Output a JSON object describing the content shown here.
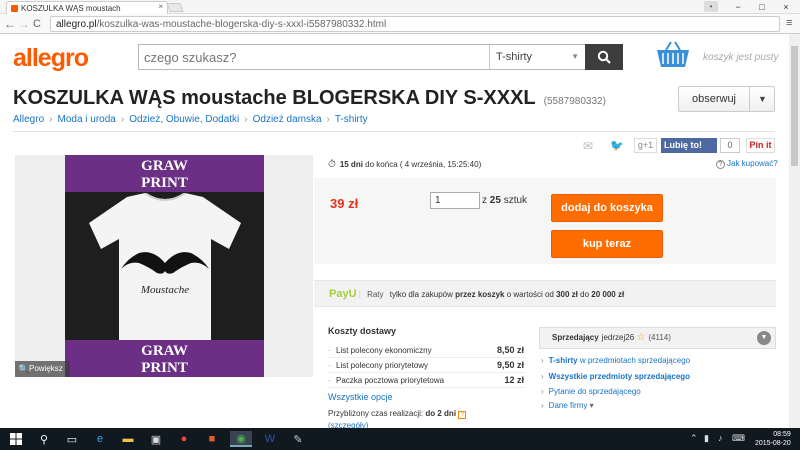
{
  "browser": {
    "tab_title": "KOSZULKA WĄS moustach",
    "tab_close": "×",
    "url_host": "allegro.pl",
    "url_path": "/koszulka-was-moustache-blogerska-diy-s-xxxl-i5587980332.html",
    "back": "←",
    "forward": "→",
    "reload": "C",
    "menu": "≡",
    "minimize": "−",
    "maximize": "□",
    "close": "×"
  },
  "header": {
    "logo": "allegro",
    "search_placeholder": "czego szukasz?",
    "category": "T-shirty",
    "basket_label": "koszyk jest pusty",
    "brand_color": "#ff5a00"
  },
  "product": {
    "title": "KOSZULKA WĄS moustache BLOGERSKA DIY S-XXXL",
    "id": "(5587980332)",
    "follow_label": "obserwuj",
    "image_band_line1": "GRAW",
    "image_band_line2": "PRINT",
    "image_shirt_text": "Moustache",
    "zoom_label": "Powiększ"
  },
  "breadcrumbs": [
    "Allegro",
    "Moda i uroda",
    "Odzież, Obuwie, Dodatki",
    "Odzież damska",
    "T-shirty"
  ],
  "share": {
    "gplus": "g+1",
    "like": "Lubię to!",
    "like_count": "0",
    "pin": "Pin it"
  },
  "offer": {
    "time_bold": "15 dni",
    "time_rest": "do końca ( 4 września, 15:25:40)",
    "how_to_buy": "Jak kupować?",
    "price": "39 zł",
    "quantity": "1",
    "stock_prefix": "z",
    "stock_count": "25",
    "stock_unit": "sztuk",
    "add_to_cart": "dodaj do koszyka",
    "buy_now": "kup teraz",
    "accent_color": "#ff6d00"
  },
  "payu": {
    "brand": "PayU",
    "raty": "Raty",
    "text1": "tylko dla zakupów",
    "text_bold1": "przez koszyk",
    "text2": "o wartości od",
    "text_bold2": "300 zł",
    "text3": "do",
    "text_bold3": "20 000 zł"
  },
  "shipping": {
    "title": "Koszty dostawy",
    "rows": [
      {
        "name": "List polecony ekonomiczny",
        "price": "8,50 zł"
      },
      {
        "name": "List polecony priorytetowy",
        "price": "9,50 zł"
      },
      {
        "name": "Paczka pocztowa priorytetowa",
        "price": "12 zł"
      }
    ],
    "more_options": "Wszystkie opcje",
    "eta_label": "Przybliżony czas realizacji:",
    "eta_value": "do 2 dni",
    "eta_link": "(szczegóły)"
  },
  "seller": {
    "label": "Sprzedający",
    "nick": "jedrzej26",
    "rating": "(4114)",
    "links": [
      {
        "bold": "T-shirty",
        "rest": "w przedmiotach sprzedającego"
      },
      {
        "bold": "Wszystkie przedmioty sprzedającego",
        "rest": ""
      },
      {
        "bold": "",
        "rest": "Pytanie do sprzedającego"
      },
      {
        "bold": "",
        "rest": "Dane firmy"
      }
    ]
  },
  "taskbar": {
    "time": "08:59",
    "date": "2015-08-20"
  }
}
